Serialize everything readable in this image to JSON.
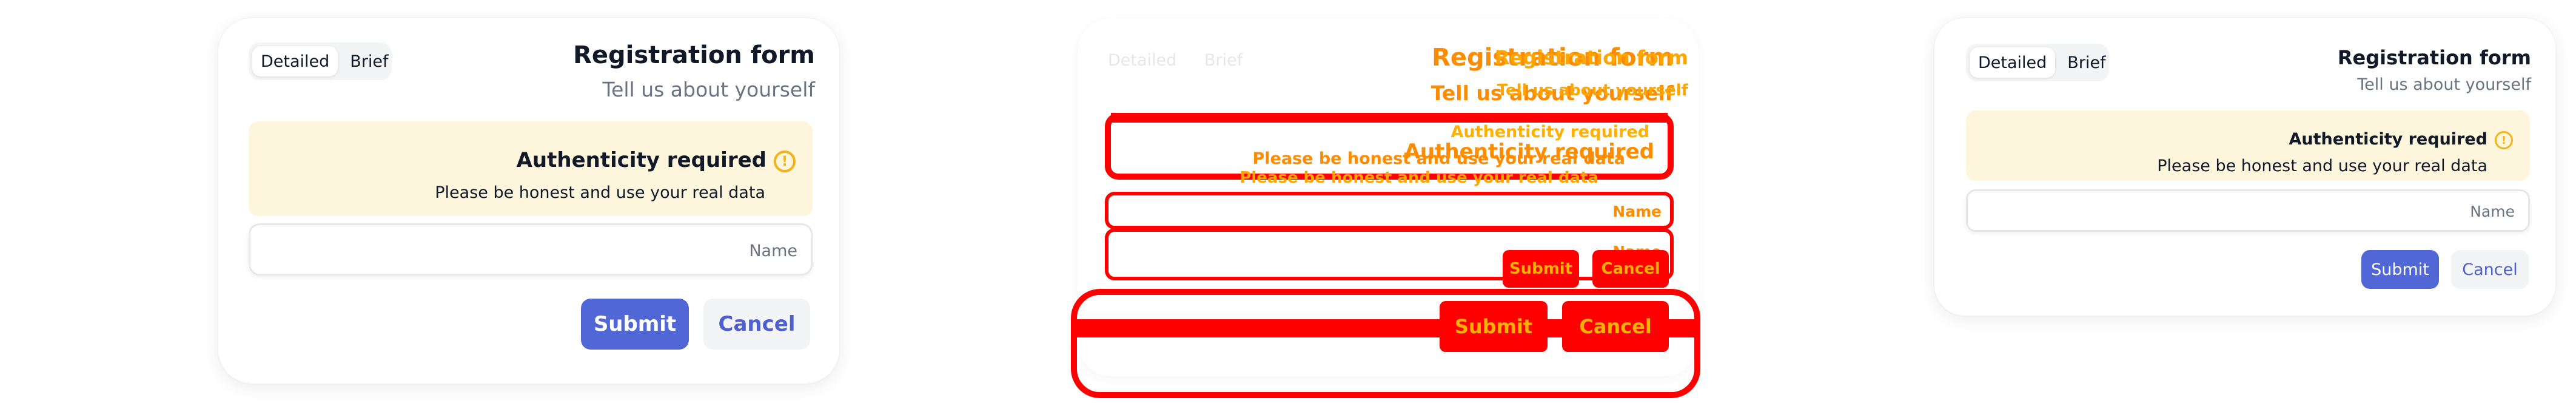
{
  "left_form": {
    "mode_detailed": "Detailed",
    "mode_brief": "Brief",
    "title": "Registration form",
    "subtitle": "Tell us about yourself",
    "notice_title": "Authenticity required",
    "notice_icon": "!",
    "notice_text": "Please be honest and use your real data",
    "name_placeholder": "Name",
    "submit_label": "Submit",
    "cancel_label": "Cancel"
  },
  "middle_form": {
    "mode_detailed": "Detailed",
    "mode_brief": "Brief",
    "title": "Registration form",
    "subtitle": "Tell us about yourself",
    "notice_title": "Authenticity required",
    "notice_text": "Please be honest and use your real data",
    "name_placeholder": "Name",
    "submit_label": "Submit",
    "cancel_label": "Cancel"
  },
  "right_form": {
    "mode_detailed": "Detailed",
    "mode_brief": "Brief",
    "title": "Registration form",
    "subtitle": "Tell us about yourself",
    "notice_title": "Authenticity required",
    "notice_icon": "!",
    "notice_text": "Please be honest and use your real data",
    "name_placeholder": "Name",
    "submit_label": "Submit",
    "cancel_label": "Cancel"
  },
  "colors": {
    "primary": "#5167d6",
    "notice_bg": "#fdf6dc",
    "warning": "#f2b31b",
    "debug_red": "#ff0000",
    "debug_orange": "#ff8c00"
  }
}
